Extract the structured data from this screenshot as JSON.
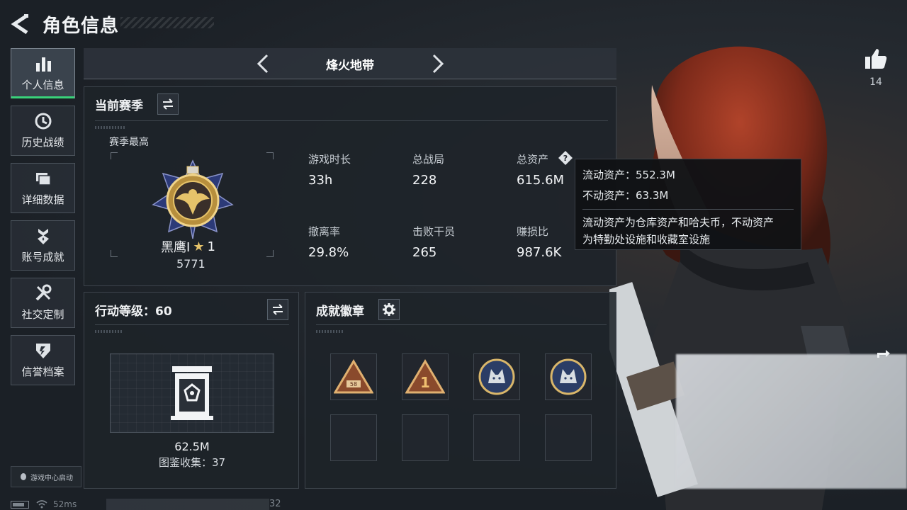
{
  "header": {
    "title": "角色信息"
  },
  "sidebar": {
    "items": [
      {
        "label": "个人信息",
        "icon": "bar-chart-icon",
        "active": true
      },
      {
        "label": "历史战绩",
        "icon": "clock-icon"
      },
      {
        "label": "详细数据",
        "icon": "folder-icon"
      },
      {
        "label": "账号成就",
        "icon": "medal-icon"
      },
      {
        "label": "社交定制",
        "icon": "tools-icon"
      },
      {
        "label": "信誉档案",
        "icon": "shield-icon"
      }
    ],
    "launch": "游戏中心启动"
  },
  "status": {
    "ping": "52ms",
    "extra": "32"
  },
  "mode": {
    "title": "烽火地带"
  },
  "season": {
    "title": "当前赛季",
    "best_label": "赛季最高",
    "rank_name": "黑鹰I",
    "rank_star": "★",
    "rank_level": "1",
    "rank_score": "5771",
    "stats": [
      {
        "label": "游戏时长",
        "value": "33h"
      },
      {
        "label": "总战局",
        "value": "228"
      },
      {
        "label": "总资产",
        "value": "615.6M"
      },
      {
        "label": "撤离率",
        "value": "29.8%"
      },
      {
        "label": "击败干员",
        "value": "265"
      },
      {
        "label": "赚损比",
        "value": "987.6K"
      }
    ]
  },
  "tooltip": {
    "liquid": "流动资产：552.3M",
    "fixed": "不动资产：63.3M",
    "desc1": "流动资产为仓库资产和哈夫币，不动资产",
    "desc2": "为特勤处设施和收藏室设施"
  },
  "action": {
    "title": "行动等级：60",
    "value": "62.5M",
    "collect": "图鉴收集：37"
  },
  "badges": {
    "title": "成就徽章"
  },
  "likes": {
    "count": "14"
  },
  "colors": {
    "accent": "#39d27a",
    "gold": "#e6c36a"
  }
}
